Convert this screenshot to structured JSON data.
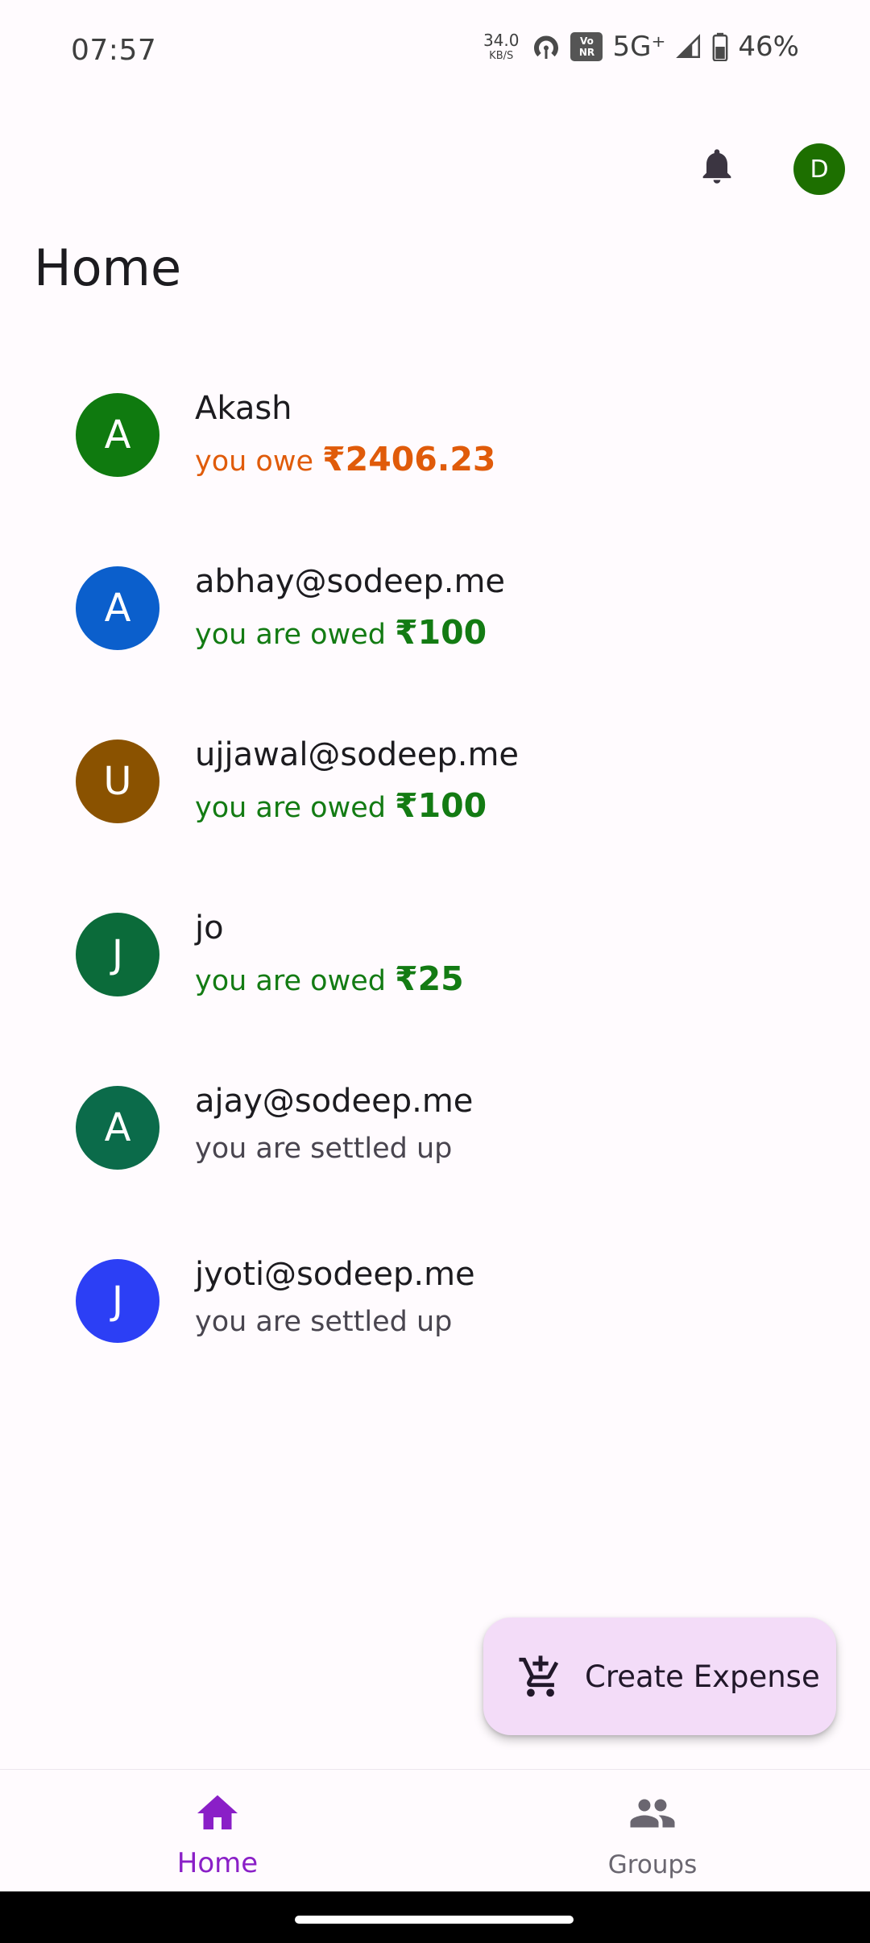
{
  "status_bar": {
    "time": "07:57",
    "net_speed_value": "34.0",
    "net_speed_unit": "KB/S",
    "volte_line1": "Vo",
    "volte_line2": "NR",
    "network_type": "5G⁺",
    "battery": "46%"
  },
  "header": {
    "title": "Home",
    "profile_initial": "D",
    "profile_color": "#1d6f00"
  },
  "friends": [
    {
      "initial": "A",
      "color": "#0f7a0f",
      "name": "Akash",
      "status_text": "you owe ",
      "amount": "₹2406.23",
      "type": "owe"
    },
    {
      "initial": "A",
      "color": "#0b5fcc",
      "name": "abhay@sodeep.me",
      "status_text": "you are owed ",
      "amount": "₹100",
      "type": "owed"
    },
    {
      "initial": "U",
      "color": "#8a5200",
      "name": "ujjawal@sodeep.me",
      "status_text": "you are owed ",
      "amount": "₹100",
      "type": "owed"
    },
    {
      "initial": "J",
      "color": "#0b6b3a",
      "name": "jo",
      "status_text": "you are owed ",
      "amount": "₹25",
      "type": "owed"
    },
    {
      "initial": "A",
      "color": "#0b6b4a",
      "name": "ajay@sodeep.me",
      "status_text": "you are settled up",
      "amount": "",
      "type": "settled"
    },
    {
      "initial": "J",
      "color": "#2c3ff5",
      "name": "jyoti@sodeep.me",
      "status_text": "you are settled up",
      "amount": "",
      "type": "settled"
    }
  ],
  "fab": {
    "label": "Create Expense",
    "icon": "add-shopping-cart-icon"
  },
  "bottom_nav": {
    "items": [
      {
        "label": "Home",
        "icon": "home-icon",
        "active": true
      },
      {
        "label": "Groups",
        "icon": "groups-icon",
        "active": false
      }
    ]
  },
  "colors": {
    "owe": "#e05b0a",
    "owed": "#137b13",
    "settled": "#49454f",
    "accent": "#8a1fc7",
    "fab_bg": "#f3dcf8"
  }
}
